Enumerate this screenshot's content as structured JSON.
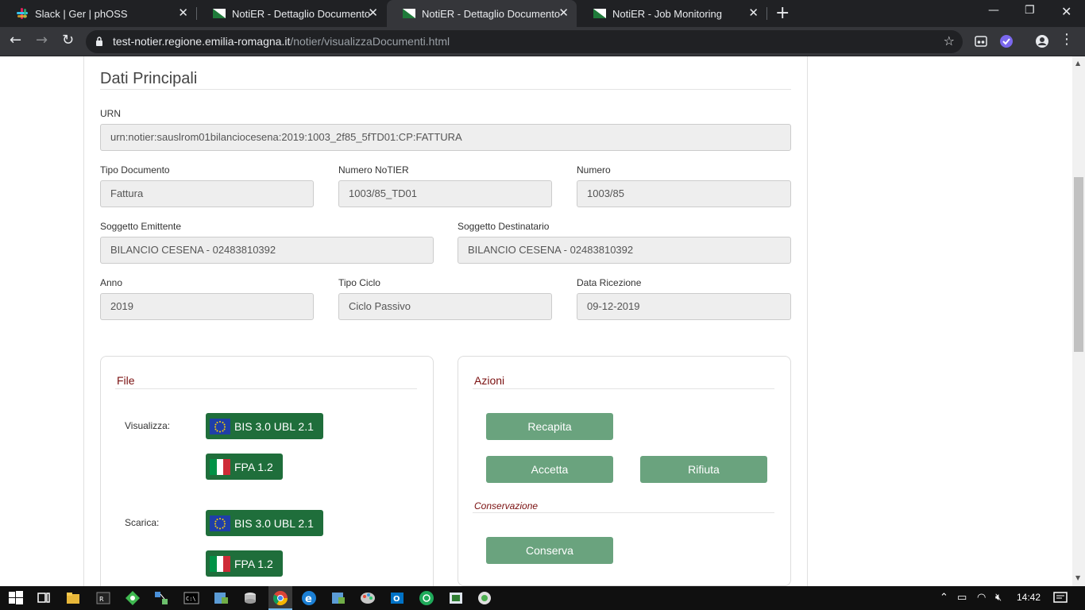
{
  "browser": {
    "tabs": [
      {
        "title": "Slack | Ger | phOSS",
        "favicon": "slack-icon"
      },
      {
        "title": "NotiER - Dettaglio Documento",
        "favicon": "emilia-romagna-flag-icon"
      },
      {
        "title": "NotiER - Dettaglio Documento",
        "favicon": "emilia-romagna-flag-icon"
      },
      {
        "title": "NotiER - Job Monitoring",
        "favicon": "emilia-romagna-flag-icon"
      }
    ],
    "close_glyph": "✕",
    "new_tab_glyph": "+",
    "url_host": "test-notier.regione.emilia-romagna.it",
    "url_path": "/notier/visualizzaDocumenti.html"
  },
  "page": {
    "section_title": "Dati Principali",
    "fields": {
      "urn": {
        "label": "URN",
        "value": "urn:notier:sauslrom01bilanciocesena:2019:1003_2f85_5fTD01:CP:FATTURA"
      },
      "tipo_documento": {
        "label": "Tipo Documento",
        "value": "Fattura"
      },
      "numero_notier": {
        "label": "Numero NoTIER",
        "value": "1003/85_TD01"
      },
      "numero": {
        "label": "Numero",
        "value": "1003/85"
      },
      "soggetto_emittente": {
        "label": "Soggetto Emittente",
        "value": "BILANCIO CESENA - 02483810392"
      },
      "soggetto_destinatario": {
        "label": "Soggetto Destinatario",
        "value": "BILANCIO CESENA - 02483810392"
      },
      "anno": {
        "label": "Anno",
        "value": "2019"
      },
      "tipo_ciclo": {
        "label": "Tipo Ciclo",
        "value": "Ciclo Passivo"
      },
      "data_ricezione": {
        "label": "Data Ricezione",
        "value": "09-12-2019"
      }
    },
    "file_card": {
      "title": "File",
      "visualizza_label": "Visualizza:",
      "scarica_label": "Scarica:",
      "bis_label": "BIS 3.0 UBL 2.1",
      "fpa_label": "FPA 1.2"
    },
    "azioni_card": {
      "title": "Azioni",
      "recapita": "Recapita",
      "accetta": "Accetta",
      "rifiuta": "Rifiuta",
      "conservazione_title": "Conservazione",
      "conserva": "Conserva"
    }
  },
  "taskbar": {
    "clock": "14:42"
  },
  "colors": {
    "action_button": "#6aa37e",
    "format_button": "#1f6e3b",
    "card_title": "#7a1010"
  }
}
